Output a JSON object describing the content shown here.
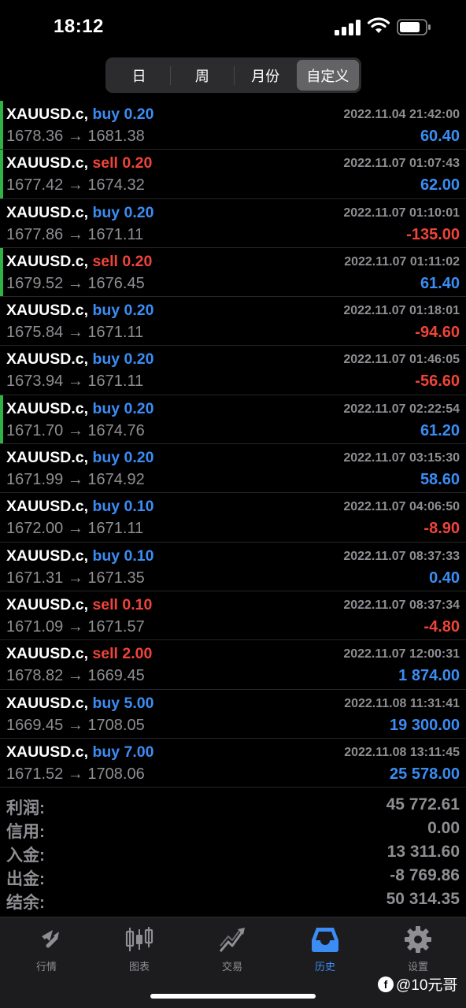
{
  "status_bar": {
    "time": "18:12"
  },
  "segmented": {
    "items": [
      "日",
      "周",
      "月份",
      "自定义"
    ],
    "selected": "自定义"
  },
  "trades": [
    {
      "symbol": "XAUUSD.c,",
      "side": "buy",
      "volume": "0.20",
      "time": "2022.11.04 21:42:00",
      "prices": "1678.36 → 1681.38",
      "profit": "60.40",
      "positive": true,
      "marked": true
    },
    {
      "symbol": "XAUUSD.c,",
      "side": "sell",
      "volume": "0.20",
      "time": "2022.11.07 01:07:43",
      "prices": "1677.42 → 1674.32",
      "profit": "62.00",
      "positive": true,
      "marked": true
    },
    {
      "symbol": "XAUUSD.c,",
      "side": "buy",
      "volume": "0.20",
      "time": "2022.11.07 01:10:01",
      "prices": "1677.86 → 1671.11",
      "profit": "-135.00",
      "positive": false,
      "marked": false
    },
    {
      "symbol": "XAUUSD.c,",
      "side": "sell",
      "volume": "0.20",
      "time": "2022.11.07 01:11:02",
      "prices": "1679.52 → 1676.45",
      "profit": "61.40",
      "positive": true,
      "marked": true
    },
    {
      "symbol": "XAUUSD.c,",
      "side": "buy",
      "volume": "0.20",
      "time": "2022.11.07 01:18:01",
      "prices": "1675.84 → 1671.11",
      "profit": "-94.60",
      "positive": false,
      "marked": false
    },
    {
      "symbol": "XAUUSD.c,",
      "side": "buy",
      "volume": "0.20",
      "time": "2022.11.07 01:46:05",
      "prices": "1673.94 → 1671.11",
      "profit": "-56.60",
      "positive": false,
      "marked": false
    },
    {
      "symbol": "XAUUSD.c,",
      "side": "buy",
      "volume": "0.20",
      "time": "2022.11.07 02:22:54",
      "prices": "1671.70 → 1674.76",
      "profit": "61.20",
      "positive": true,
      "marked": true
    },
    {
      "symbol": "XAUUSD.c,",
      "side": "buy",
      "volume": "0.20",
      "time": "2022.11.07 03:15:30",
      "prices": "1671.99 → 1674.92",
      "profit": "58.60",
      "positive": true,
      "marked": false
    },
    {
      "symbol": "XAUUSD.c,",
      "side": "buy",
      "volume": "0.10",
      "time": "2022.11.07 04:06:50",
      "prices": "1672.00 → 1671.11",
      "profit": "-8.90",
      "positive": false,
      "marked": false
    },
    {
      "symbol": "XAUUSD.c,",
      "side": "buy",
      "volume": "0.10",
      "time": "2022.11.07 08:37:33",
      "prices": "1671.31 → 1671.35",
      "profit": "0.40",
      "positive": true,
      "marked": false
    },
    {
      "symbol": "XAUUSD.c,",
      "side": "sell",
      "volume": "0.10",
      "time": "2022.11.07 08:37:34",
      "prices": "1671.09 → 1671.57",
      "profit": "-4.80",
      "positive": false,
      "marked": false
    },
    {
      "symbol": "XAUUSD.c,",
      "side": "sell",
      "volume": "2.00",
      "time": "2022.11.07 12:00:31",
      "prices": "1678.82 → 1669.45",
      "profit": "1 874.00",
      "positive": true,
      "marked": false
    },
    {
      "symbol": "XAUUSD.c,",
      "side": "buy",
      "volume": "5.00",
      "time": "2022.11.08 11:31:41",
      "prices": "1669.45 → 1708.05",
      "profit": "19 300.00",
      "positive": true,
      "marked": false
    },
    {
      "symbol": "XAUUSD.c,",
      "side": "buy",
      "volume": "7.00",
      "time": "2022.11.08 13:11:45",
      "prices": "1671.52 → 1708.06",
      "profit": "25 578.00",
      "positive": true,
      "marked": false
    }
  ],
  "summary": [
    {
      "label": "利润:",
      "value": "45 772.61"
    },
    {
      "label": "信用:",
      "value": "0.00"
    },
    {
      "label": "入金:",
      "value": "13 311.60"
    },
    {
      "label": "出金:",
      "value": "-8 769.86"
    },
    {
      "label": "结余:",
      "value": "50 314.35"
    }
  ],
  "tabs": [
    {
      "label": "行情",
      "icon": "quotes-icon",
      "active": false
    },
    {
      "label": "图表",
      "icon": "chart-icon",
      "active": false
    },
    {
      "label": "交易",
      "icon": "trade-icon",
      "active": false
    },
    {
      "label": "历史",
      "icon": "history-icon",
      "active": true
    },
    {
      "label": "设置",
      "icon": "settings-icon",
      "active": false
    }
  ],
  "watermark": {
    "logo": "f",
    "text": "@10元哥"
  },
  "colors": {
    "buy": "#3b8df5",
    "sell": "#f0443a",
    "accent_mark": "#2fb344",
    "muted": "#8e8e93"
  }
}
